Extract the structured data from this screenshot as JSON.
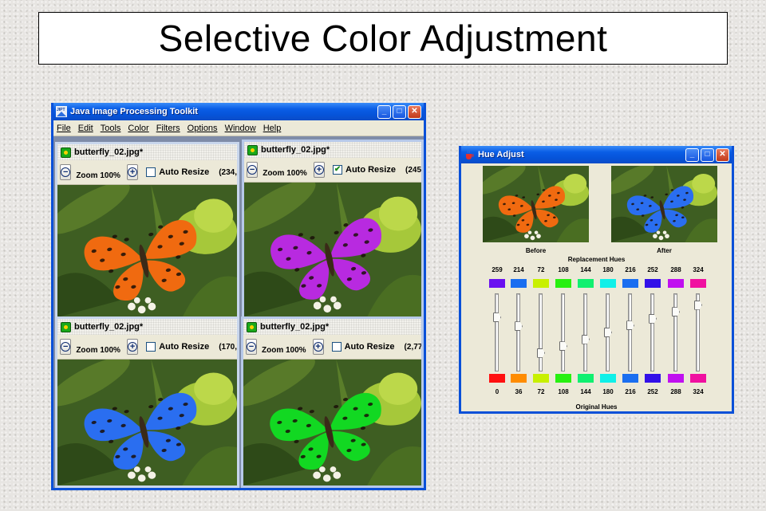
{
  "slide": {
    "title": "Selective Color Adjustment"
  },
  "toolkit": {
    "title": "Java Image Processing Toolkit",
    "menu": [
      "File",
      "Edit",
      "Tools",
      "Color",
      "Filters",
      "Options",
      "Window",
      "Help"
    ],
    "frames": [
      {
        "title": "butterfly_02.jpg*",
        "zoom": "Zoom 100%",
        "auto_resize_label": "Auto Resize",
        "auto_resize_checked": false,
        "coords": "(234,",
        "butterfly_color": "#f06a10"
      },
      {
        "title": "butterfly_02.jpg*",
        "zoom": "Zoom 100%",
        "auto_resize_label": "Auto Resize",
        "auto_resize_checked": true,
        "coords": "(245",
        "butterfly_color": "#b82ae0"
      },
      {
        "title": "butterfly_02.jpg*",
        "zoom": "Zoom 100%",
        "auto_resize_label": "Auto Resize",
        "auto_resize_checked": false,
        "coords": "(170,",
        "butterfly_color": "#2a6ef0"
      },
      {
        "title": "butterfly_02.jpg*",
        "zoom": "Zoom 100%",
        "auto_resize_label": "Auto Resize",
        "auto_resize_checked": false,
        "coords": "(2,77",
        "butterfly_color": "#12d822"
      }
    ]
  },
  "hue_adjust": {
    "title": "Hue Adjust",
    "before_label": "Before",
    "after_label": "After",
    "replacement_label": "Replacement Hues",
    "original_label": "Original Hues",
    "before_color": "#f06a10",
    "after_color": "#2a6ef0",
    "replacement_values": [
      "259",
      "214",
      "72",
      "108",
      "144",
      "180",
      "216",
      "252",
      "288",
      "324"
    ],
    "original_values": [
      "0",
      "36",
      "72",
      "108",
      "144",
      "180",
      "216",
      "252",
      "288",
      "324"
    ],
    "replacement_colors": [
      "#6a10f0",
      "#1a6ef0",
      "#c8f000",
      "#28f010",
      "#10f070",
      "#10f0e8",
      "#1a6ef0",
      "#3210e8",
      "#c010f0",
      "#f010a0"
    ],
    "original_colors": [
      "#ff1010",
      "#ff8c00",
      "#c8f000",
      "#28f010",
      "#10f070",
      "#10f0e8",
      "#1a6ef0",
      "#3210e8",
      "#c010f0",
      "#f010a0"
    ],
    "slider_levels": [
      0.72,
      0.59,
      0.2,
      0.3,
      0.4,
      0.5,
      0.6,
      0.7,
      0.8,
      0.9
    ]
  }
}
